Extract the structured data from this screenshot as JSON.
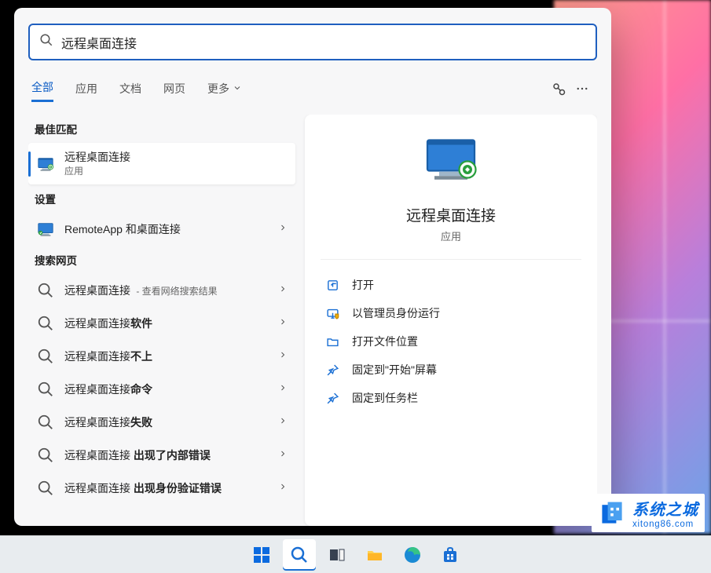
{
  "search": {
    "value": "远程桌面连接"
  },
  "tabs": {
    "items": [
      {
        "label": "全部"
      },
      {
        "label": "应用"
      },
      {
        "label": "文档"
      },
      {
        "label": "网页"
      },
      {
        "label": "更多"
      }
    ]
  },
  "left": {
    "best_match_label": "最佳匹配",
    "best_match": {
      "title": "远程桌面连接",
      "sub": "应用"
    },
    "settings_label": "设置",
    "settings_item": {
      "title": "RemoteApp 和桌面连接"
    },
    "web_label": "搜索网页",
    "web_items": [
      {
        "prefix": "远程桌面连接",
        "bold": "",
        "suffix": " - 查看网络搜索结果"
      },
      {
        "prefix": "远程桌面连接",
        "bold": "软件",
        "suffix": ""
      },
      {
        "prefix": "远程桌面连接",
        "bold": "不上",
        "suffix": ""
      },
      {
        "prefix": "远程桌面连接",
        "bold": "命令",
        "suffix": ""
      },
      {
        "prefix": "远程桌面连接",
        "bold": "失败",
        "suffix": ""
      },
      {
        "prefix": "远程桌面连接 ",
        "bold": "出现了内部错误",
        "suffix": ""
      },
      {
        "prefix": "远程桌面连接 ",
        "bold": "出现身份验证错误",
        "suffix": ""
      }
    ]
  },
  "right": {
    "title": "远程桌面连接",
    "sub": "应用",
    "actions": [
      {
        "label": "打开",
        "icon": "open"
      },
      {
        "label": "以管理员身份运行",
        "icon": "admin"
      },
      {
        "label": "打开文件位置",
        "icon": "folder"
      },
      {
        "label": "固定到\"开始\"屏幕",
        "icon": "pin"
      },
      {
        "label": "固定到任务栏",
        "icon": "pin"
      }
    ]
  },
  "watermark": {
    "main": "系统之城",
    "sub": "xitong86.com"
  }
}
